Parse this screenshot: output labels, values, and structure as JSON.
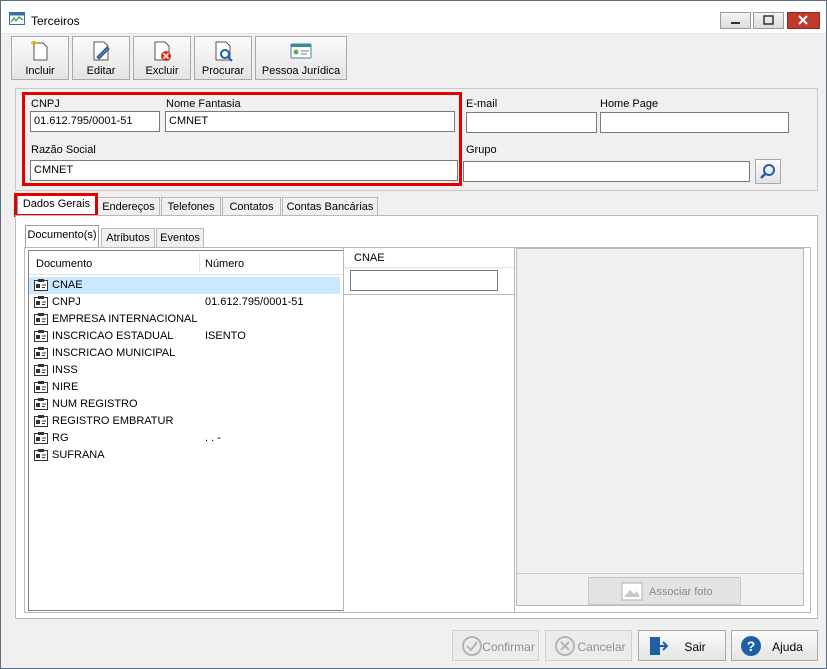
{
  "window": {
    "title": "Terceiros",
    "title_icon": "chart-window-icon"
  },
  "toolbar": {
    "items": [
      {
        "label": "Incluir",
        "icon": "new-document-icon"
      },
      {
        "label": "Editar",
        "icon": "edit-document-icon"
      },
      {
        "label": "Excluir",
        "icon": "delete-document-icon"
      },
      {
        "label": "Procurar",
        "icon": "search-document-icon"
      },
      {
        "label": "Pessoa Jurídica",
        "icon": "id-card-icon"
      }
    ]
  },
  "form": {
    "cnpj_label": "CNPJ",
    "cnpj_value": "01.612.795/0001-51",
    "nome_fantasia_label": "Nome Fantasia",
    "nome_fantasia_value": "CMNET",
    "razao_social_label": "Razão Social",
    "razao_social_value": "CMNET",
    "email_label": "E-mail",
    "email_value": "",
    "home_page_label": "Home Page",
    "home_page_value": "",
    "grupo_label": "Grupo",
    "grupo_value": ""
  },
  "main_tabs": [
    "Dados Gerais",
    "Endereços",
    "Telefones",
    "Contatos",
    "Contas Bancárias"
  ],
  "sub_tabs": [
    "Documento(s)",
    "Atributos",
    "Eventos"
  ],
  "documents": {
    "col_documento": "Documento",
    "col_numero": "Número",
    "rows": [
      {
        "name": "CNAE",
        "number": ""
      },
      {
        "name": "CNPJ",
        "number": "01.612.795/0001-51"
      },
      {
        "name": "EMPRESA INTERNACIONAL",
        "number": ""
      },
      {
        "name": "INSCRICAO ESTADUAL",
        "number": "ISENTO"
      },
      {
        "name": "INSCRICAO MUNICIPAL",
        "number": ""
      },
      {
        "name": "INSS",
        "number": ""
      },
      {
        "name": "NIRE",
        "number": ""
      },
      {
        "name": "NUM REGISTRO",
        "number": ""
      },
      {
        "name": "REGISTRO EMBRATUR",
        "number": ""
      },
      {
        "name": "RG",
        "number": ".   .   -"
      },
      {
        "name": "SUFRANA",
        "number": ""
      }
    ]
  },
  "cnae": {
    "label": "CNAE",
    "value": ""
  },
  "photo": {
    "button_label": "Associar foto"
  },
  "buttons": {
    "confirmar": "Confirmar",
    "cancelar": "Cancelar",
    "sair": "Sair",
    "ajuda": "Ajuda"
  },
  "colors": {
    "highlight": "#e00000",
    "selection": "#cce8ff",
    "accent": "#1e5fa8"
  }
}
